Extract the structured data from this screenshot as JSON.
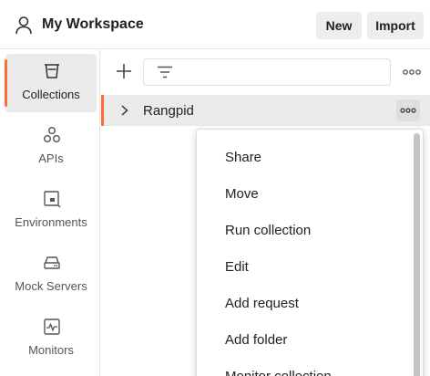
{
  "header": {
    "workspace_icon": "user-icon",
    "title": "My Workspace",
    "new_label": "New",
    "import_label": "Import"
  },
  "sidebar": {
    "items": [
      {
        "label": "Collections",
        "icon": "collections-icon",
        "active": true
      },
      {
        "label": "APIs",
        "icon": "apis-icon",
        "active": false
      },
      {
        "label": "Environments",
        "icon": "environments-icon",
        "active": false
      },
      {
        "label": "Mock Servers",
        "icon": "mock-servers-icon",
        "active": false
      },
      {
        "label": "Monitors",
        "icon": "monitors-icon",
        "active": false
      }
    ]
  },
  "toolbar": {
    "add_icon": "plus-icon",
    "filter_icon": "filter-icon",
    "more_icon": "more-horizontal-icon"
  },
  "collection": {
    "name": "Rangpid",
    "expand_icon": "chevron-right-icon",
    "more_icon": "more-horizontal-icon"
  },
  "context_menu": {
    "items": [
      "Share",
      "Move",
      "Run collection",
      "Edit",
      "Add request",
      "Add folder",
      "Monitor collection"
    ]
  },
  "colors": {
    "accent": "#ff6c37",
    "active_bg": "#ebebeb",
    "button_bg": "#ededed"
  }
}
